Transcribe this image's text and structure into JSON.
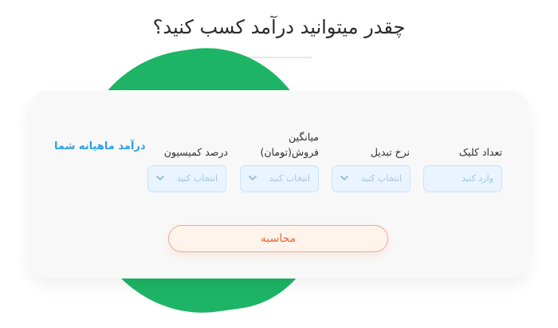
{
  "title": "چقدر میتوانید درآمد کسب کنید؟",
  "result_label": "درآمد ماهیانه شما",
  "fields": [
    {
      "label": "تعداد کلیک",
      "placeholder": "وارد کنید",
      "type": "input"
    },
    {
      "label": "نرخ تبدیل",
      "placeholder": "انتخاب کنید",
      "type": "select"
    },
    {
      "label_line1": "میانگین",
      "label_line2": "فروش(تومان)",
      "placeholder": "انتخاب کنید",
      "type": "select"
    },
    {
      "label": "درصد کمیسیون",
      "placeholder": "انتخاب کنید",
      "type": "select"
    }
  ],
  "calculate_label": "محاسبه",
  "colors": {
    "accent_green": "#1db565",
    "accent_blue": "#2f9fe3",
    "button_orange": "#e8693a"
  }
}
